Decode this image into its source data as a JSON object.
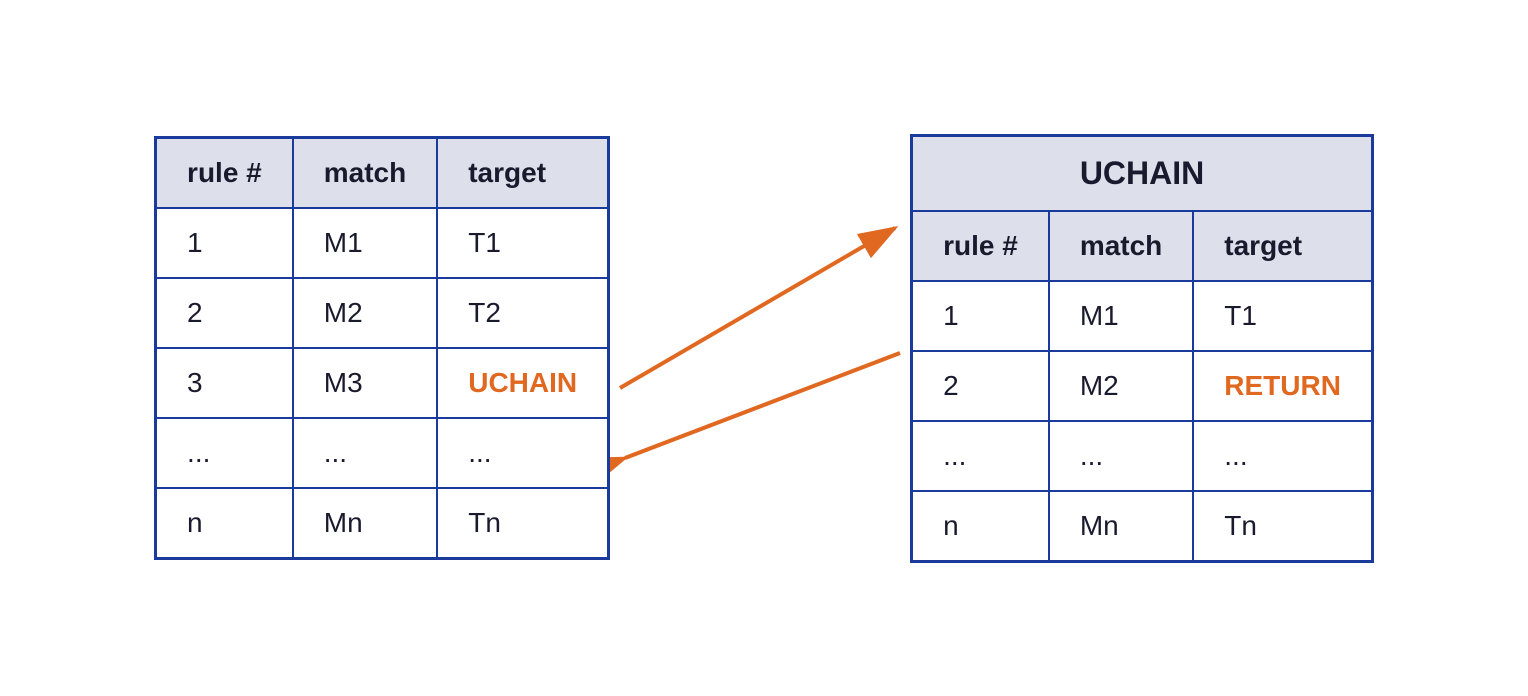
{
  "left_table": {
    "headers": [
      "rule #",
      "match",
      "target"
    ],
    "rows": [
      {
        "rule": "1",
        "match": "M1",
        "target": "T1",
        "target_orange": false
      },
      {
        "rule": "2",
        "match": "M2",
        "target": "T2",
        "target_orange": false
      },
      {
        "rule": "3",
        "match": "M3",
        "target": "UCHAIN",
        "target_orange": true
      },
      {
        "rule": "...",
        "match": "...",
        "target": "...",
        "target_orange": false
      },
      {
        "rule": "n",
        "match": "Mn",
        "target": "Tn",
        "target_orange": false
      }
    ]
  },
  "right_table": {
    "title": "UCHAIN",
    "headers": [
      "rule #",
      "match",
      "target"
    ],
    "rows": [
      {
        "rule": "1",
        "match": "M1",
        "target": "T1",
        "target_orange": false
      },
      {
        "rule": "2",
        "match": "M2",
        "target": "RETURN",
        "target_orange": true
      },
      {
        "rule": "...",
        "match": "...",
        "target": "...",
        "target_orange": false
      },
      {
        "rule": "n",
        "match": "Mn",
        "target": "Tn",
        "target_orange": false
      }
    ]
  },
  "colors": {
    "border": "#1a3a9c",
    "header_bg": "#dde0ea",
    "orange": "#e06820",
    "text": "#1a1a2e"
  }
}
